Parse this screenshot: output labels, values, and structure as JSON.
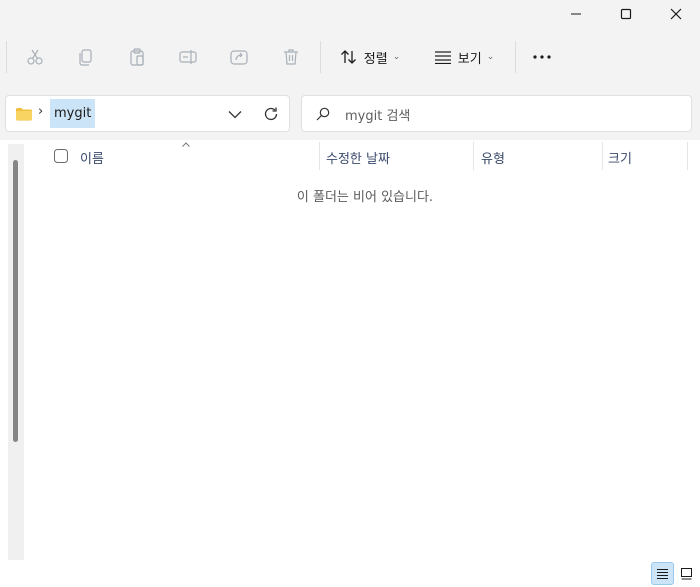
{
  "window": {
    "minimize_icon": "minimize-icon",
    "maximize_icon": "maximize-icon",
    "close_icon": "close-icon"
  },
  "toolbar": {
    "sort_label": "정렬",
    "view_label": "보기",
    "more_label": "···"
  },
  "address": {
    "current_folder": "mygit"
  },
  "search": {
    "placeholder": "mygit 검색"
  },
  "columns": {
    "name": "이름",
    "modified": "수정한 날짜",
    "type": "유형",
    "size": "크기"
  },
  "content": {
    "empty_message": "이 폴더는 비어 있습니다."
  },
  "colors": {
    "chrome_bg": "#f3f3f3",
    "selection": "#cce4f7",
    "folder": "#f0c040",
    "accent": "#0a64c8"
  }
}
